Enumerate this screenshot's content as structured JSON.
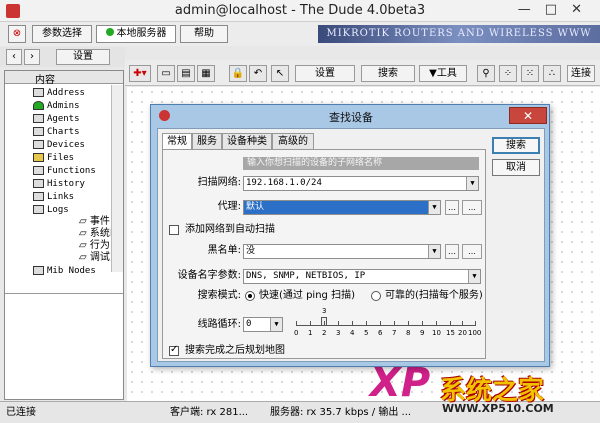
{
  "window": {
    "title": "admin@localhost - The Dude 4.0beta3"
  },
  "menubar": {
    "settings": "参数选择",
    "local_server": "本地服务器",
    "help": "帮助"
  },
  "banner": "MIKROTIK ROUTERS AND WIRELESS WWW",
  "toolbar_left": {
    "settings": "设置"
  },
  "sidebar": {
    "header": "内容",
    "items": [
      "Address",
      "Admins",
      "Agents",
      "Charts",
      "Devices",
      "Files",
      "Functions",
      "History",
      "Links",
      "Logs",
      "Mib Nodes"
    ],
    "logs_children": [
      "事件",
      "系统E",
      "行为",
      "调试]"
    ]
  },
  "toolbar_right": {
    "settings": "设置",
    "discover": "搜索",
    "tools": "工具",
    "dropdown_tools": "▼工具",
    "layout": "连接"
  },
  "dialog": {
    "title": "查找设备",
    "tabs": [
      "常规",
      "服务",
      "设备种类",
      "高级的"
    ],
    "hint": "输入你想扫描的设备的子网络名称",
    "scan_network_label": "扫描网络:",
    "scan_network_value": "192.168.1.0/24",
    "agent_label": "代理:",
    "agent_value": "默认",
    "add_to_auto_scan": "添加网络到自动扫描",
    "black_list_label": "黑名单:",
    "black_list_value": "没",
    "device_name_pref_label": "设备名字参数:",
    "device_name_pref_value": "DNS, SNMP, NETBIOS, IP",
    "discover_mode_label": "搜索模式:",
    "mode_fast": "快速(通过 ping 扫描)",
    "mode_reliable": "可靠的(扫描每个服务)",
    "hops_label": "线路循环:",
    "hops_value": "0",
    "hop_scale": [
      "0",
      "1",
      "2",
      "3",
      "4",
      "5",
      "6",
      "7",
      "8",
      "9",
      "10",
      "15",
      "20",
      "100"
    ],
    "layout_checkbox": "搜索完成之后规划地图",
    "btn_discover": "搜索",
    "btn_cancel": "取消",
    "btn_more": "…",
    "btn_ellipsis": "...",
    "thumb_val": "3"
  },
  "status": {
    "connected": "已连接",
    "client": "客户端: rx 281...",
    "server": "服务器: rx 35.7 kbps / 输出 ..."
  },
  "logo": {
    "xp": "XP",
    "cn": "系统之家",
    "url": "WWW.XP510.COM"
  },
  "colors": {
    "dialog_frame": "#a8c8e6",
    "close_btn": "#c9463d",
    "selection": "#2b6fc7"
  }
}
